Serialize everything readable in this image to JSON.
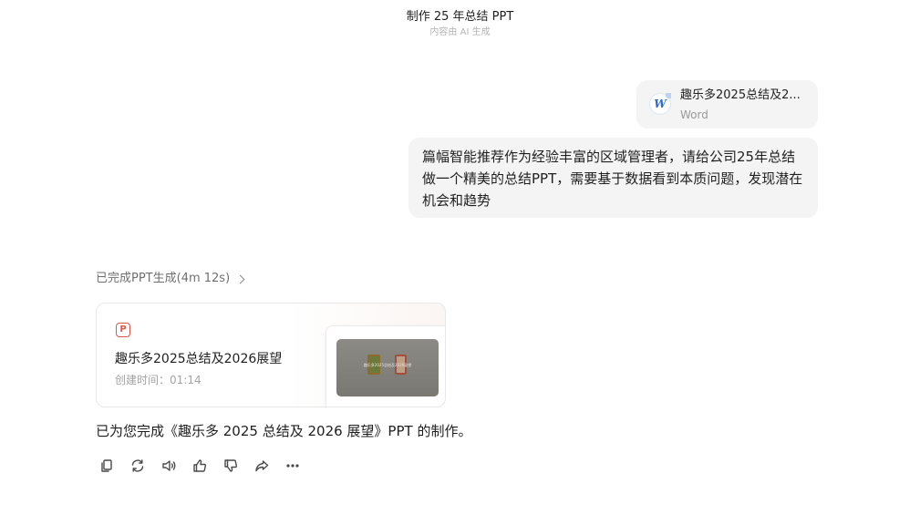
{
  "header": {
    "title": "制作 25 年总结 PPT",
    "subtitle": "内容由 AI 生成"
  },
  "attachment": {
    "name": "趣乐多2025总结及2...",
    "type": "Word",
    "icon": "word-icon",
    "icon_letter": "W",
    "accent_color": "#2b6ad6"
  },
  "user_message": {
    "text": "篇幅智能推荐作为经验丰富的区域管理者，请给公司25年总结做一个精美的总结PPT，需要基于数据看到本质问题，发现潜在机会和趋势"
  },
  "process": {
    "status": "已完成PPT生成(4m 12s)",
    "icon": "chevron-right-icon"
  },
  "ppt_card": {
    "icon_letter": "P",
    "icon_color": "#e0564a",
    "title": "趣乐多2025总结及2026展望",
    "created_label": "创建时间：01:14",
    "thumbnail_text": "趣乐多2025总结及2026展望"
  },
  "reply": {
    "text": "已为您完成《趣乐多 2025 总结及 2026 展望》PPT 的制作。"
  },
  "actions": [
    {
      "name": "copy",
      "icon": "copy-icon"
    },
    {
      "name": "regenerate",
      "icon": "refresh-icon"
    },
    {
      "name": "read-aloud",
      "icon": "speaker-icon"
    },
    {
      "name": "like",
      "icon": "thumbs-up-icon"
    },
    {
      "name": "dislike",
      "icon": "thumbs-down-icon"
    },
    {
      "name": "share",
      "icon": "share-icon"
    },
    {
      "name": "more",
      "icon": "more-icon"
    }
  ]
}
